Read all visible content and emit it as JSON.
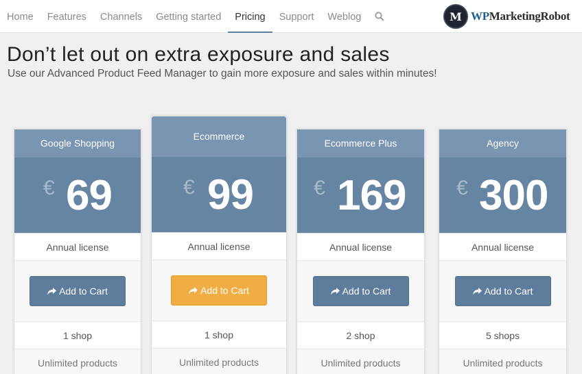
{
  "nav": {
    "items": [
      {
        "label": "Home",
        "name": "nav-item-home",
        "active": false
      },
      {
        "label": "Features",
        "name": "nav-item-features",
        "active": false
      },
      {
        "label": "Channels",
        "name": "nav-item-channels",
        "active": false
      },
      {
        "label": "Getting started",
        "name": "nav-item-getting-started",
        "active": false
      },
      {
        "label": "Pricing",
        "name": "nav-item-pricing",
        "active": true
      },
      {
        "label": "Support",
        "name": "nav-item-support",
        "active": false
      },
      {
        "label": "Weblog",
        "name": "nav-item-weblog",
        "active": false
      }
    ],
    "search_icon": "search-icon"
  },
  "logo": {
    "mark": "M",
    "text_wp": "WP",
    "text_rest": "MarketingRobot"
  },
  "hero": {
    "title": "Don’t let out on extra exposure and sales",
    "subtitle": "Use our Advanced Product Feed Manager to gain more exposure and sales within minutes!"
  },
  "plans": [
    {
      "name": "Google Shopping",
      "currency": "€",
      "price": "69",
      "license": "Annual license",
      "button": "Add to Cart",
      "featured": false,
      "shops": "1 shop",
      "products": "Unlimited products"
    },
    {
      "name": "Ecommerce",
      "currency": "€",
      "price": "99",
      "license": "Annual license",
      "button": "Add to Cart",
      "featured": true,
      "shops": "1 shop",
      "products": "Unlimited products"
    },
    {
      "name": "Ecommerce Plus",
      "currency": "€",
      "price": "169",
      "license": "Annual license",
      "button": "Add to Cart",
      "featured": false,
      "shops": "2 shop",
      "products": "Unlimited products"
    },
    {
      "name": "Agency",
      "currency": "€",
      "price": "300",
      "license": "Annual license",
      "button": "Add to Cart",
      "featured": false,
      "shops": "5 shops",
      "products": "Unlimited products"
    }
  ],
  "colors": {
    "header_bg": "#7995b2",
    "price_bg": "#6685a3",
    "button_blue": "#5e7d9c",
    "button_featured": "#f0ad44",
    "nav_active_underline": "#5f7f9c"
  }
}
